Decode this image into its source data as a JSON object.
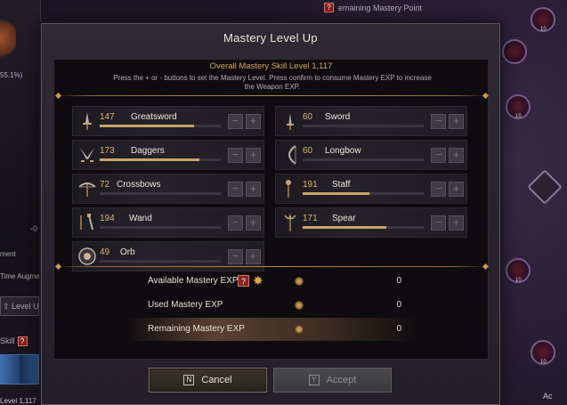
{
  "background": {
    "left_percent": "55.1%)",
    "left_label_1": "ment",
    "left_label_2": "Time Augme",
    "left_button": "Level U",
    "left_skill": "Skill",
    "left_level_footer": "Level 1,117",
    "top_banner": "emaining Mastery Point",
    "right_node_tag": "10",
    "bottom_right": "Ac",
    "dash": "-0"
  },
  "modal": {
    "title": "Mastery Level Up",
    "overall": "Overall Mastery Skill Level 1,117",
    "description": "Press the + or - buttons to set the Mastery Level. Press confirm to consume Mastery EXP to increase the Weapon EXP."
  },
  "weapons": [
    {
      "level": "147",
      "name": "Greatsword",
      "icon": "greatsword-icon",
      "progress": 0.78
    },
    {
      "level": "60",
      "name": "Sword",
      "icon": "sword-icon",
      "progress": 0.0
    },
    {
      "level": "173",
      "name": "Daggers",
      "icon": "daggers-icon",
      "progress": 0.82
    },
    {
      "level": "60",
      "name": "Longbow",
      "icon": "longbow-icon",
      "progress": 0.0
    },
    {
      "level": "72",
      "name": "Crossbows",
      "icon": "crossbow-icon",
      "progress": 0.0
    },
    {
      "level": "191",
      "name": "Staff",
      "icon": "staff-icon",
      "progress": 0.55
    },
    {
      "level": "194",
      "name": "Wand",
      "icon": "wand-icon",
      "progress": 0.0
    },
    {
      "level": "171",
      "name": "Spear",
      "icon": "spear-icon",
      "progress": 0.69
    },
    {
      "level": "49",
      "name": "Orb",
      "icon": "orb-icon",
      "progress": 0.0
    }
  ],
  "buttons": {
    "minus": "−",
    "plus": "+"
  },
  "summary": {
    "available_label": "Available Mastery EXP",
    "available_value": "0",
    "used_label": "Used Mastery EXP",
    "used_value": "0",
    "remaining_label": "Remaining Mastery EXP",
    "remaining_value": "0",
    "help": "?"
  },
  "actions": {
    "cancel_key": "N",
    "cancel_label": "Cancel",
    "accept_key": "Y",
    "accept_label": "Accept"
  },
  "colors": {
    "accent_gold": "#d9a55a",
    "progress_fill": "#c9a56a"
  }
}
